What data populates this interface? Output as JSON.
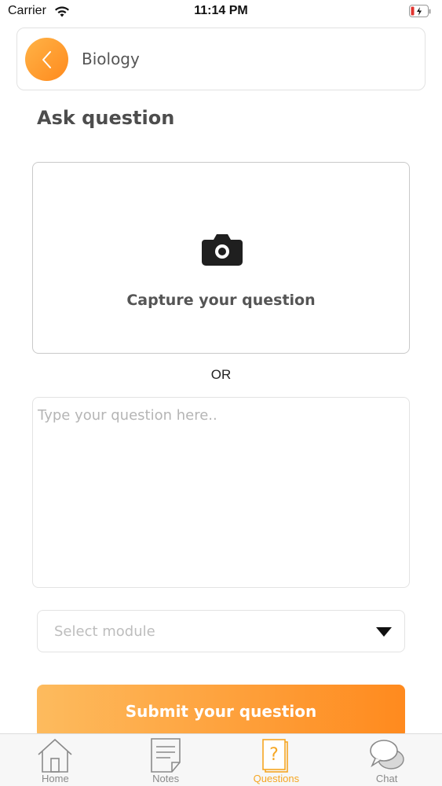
{
  "status_bar": {
    "carrier": "Carrier",
    "time": "11:14 PM"
  },
  "header": {
    "back_icon": "chevron-left-icon",
    "subject": "Biology"
  },
  "page": {
    "title": "Ask question"
  },
  "capture": {
    "icon": "camera-icon",
    "label": "Capture your question"
  },
  "divider": {
    "or_label": "OR"
  },
  "question_input": {
    "value": "",
    "placeholder": "Type your question here.."
  },
  "module_select": {
    "placeholder": "Select module",
    "icon": "caret-down-icon"
  },
  "submit": {
    "label": "Submit your question"
  },
  "tab_bar": {
    "tabs": [
      {
        "label": "Home",
        "icon": "home-icon",
        "active": false
      },
      {
        "label": "Notes",
        "icon": "notes-icon",
        "active": false
      },
      {
        "label": "Questions",
        "icon": "questions-icon",
        "active": true
      },
      {
        "label": "Chat",
        "icon": "chat-icon",
        "active": false
      }
    ]
  },
  "colors": {
    "accent_start": "#ffb347",
    "accent_end": "#ff8a1d",
    "active_tab": "#f5a623"
  }
}
